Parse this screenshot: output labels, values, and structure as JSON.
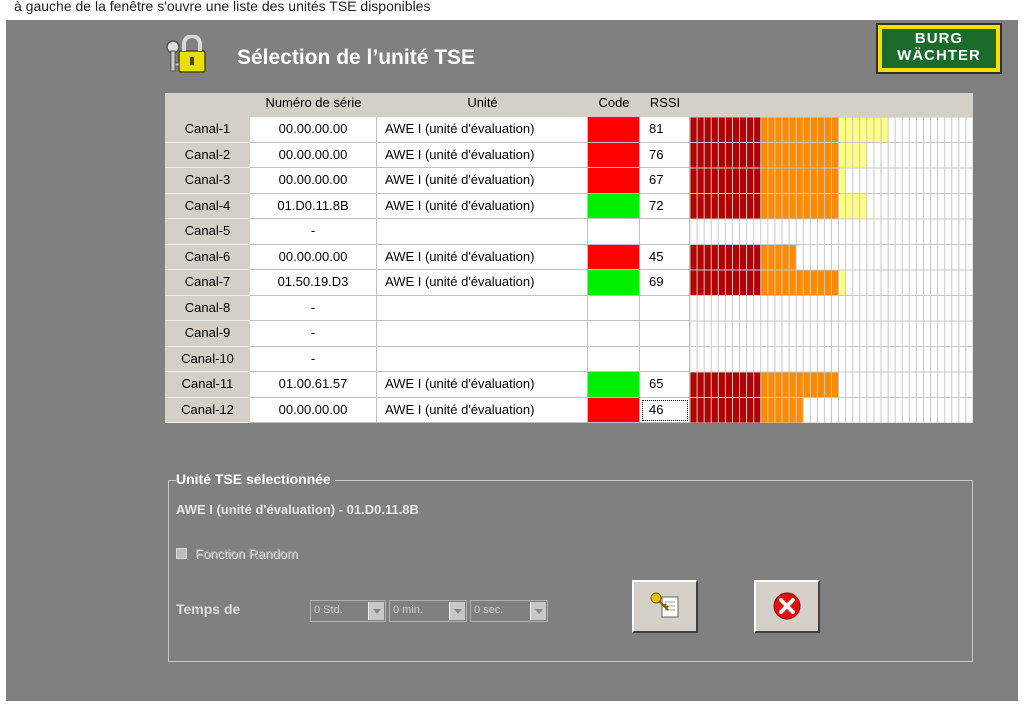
{
  "top_caption": "à gauche de la fenêtre s'ouvre une liste des unités TSE disponibles",
  "title": "Sélection de l’unité TSE",
  "logo": {
    "line1": "BURG",
    "line2": "WÄCHTER"
  },
  "table": {
    "headers": {
      "serial": "Numéro de série",
      "unit": "Unité",
      "code": "Code",
      "rssi": "RSSI"
    },
    "rows": [
      {
        "channel": "Canal-1",
        "serial": "00.00.00.00",
        "unit": "AWE I (unité d'évaluation)",
        "code": "red",
        "rssi": "81",
        "bar": 0.69
      },
      {
        "channel": "Canal-2",
        "serial": "00.00.00.00",
        "unit": "AWE I (unité d'évaluation)",
        "code": "red",
        "rssi": "76",
        "bar": 0.63
      },
      {
        "channel": "Canal-3",
        "serial": "00.00.00.00",
        "unit": "AWE I (unité d'évaluation)",
        "code": "red",
        "rssi": "67",
        "bar": 0.54
      },
      {
        "channel": "Canal-4",
        "serial": "01.D0.11.8B",
        "unit": "AWE I (unité d'évaluation)",
        "code": "green",
        "rssi": "72",
        "bar": 0.63
      },
      {
        "channel": "Canal-5",
        "serial": "-",
        "unit": "",
        "code": "",
        "rssi": "",
        "bar": 0
      },
      {
        "channel": "Canal-6",
        "serial": "00.00.00.00",
        "unit": "AWE I (unité d'évaluation)",
        "code": "red",
        "rssi": "45",
        "bar": 0.37
      },
      {
        "channel": "Canal-7",
        "serial": "01.50.19.D3",
        "unit": "AWE I (unité d'évaluation)",
        "code": "green",
        "rssi": "69",
        "bar": 0.56
      },
      {
        "channel": "Canal-8",
        "serial": "-",
        "unit": "",
        "code": "",
        "rssi": "",
        "bar": 0
      },
      {
        "channel": "Canal-9",
        "serial": "-",
        "unit": "",
        "code": "",
        "rssi": "",
        "bar": 0
      },
      {
        "channel": "Canal-10",
        "serial": "-",
        "unit": "",
        "code": "",
        "rssi": "",
        "bar": 0
      },
      {
        "channel": "Canal-11",
        "serial": "01.00.61.57",
        "unit": "AWE I (unité d'évaluation)",
        "code": "green",
        "rssi": "65",
        "bar": 0.53
      },
      {
        "channel": "Canal-12",
        "serial": "00.00.00.00",
        "unit": "AWE I (unité d'évaluation)",
        "code": "red",
        "rssi": "46",
        "bar": 0.4,
        "selected": true
      }
    ]
  },
  "bar_colors": [
    "#b30000",
    "#ff8c00",
    "#ffff80"
  ],
  "selection": {
    "group_label": "Unité TSE sélectionnée",
    "selected_text": "AWE I (unité d'évaluation) - 01.D0.11.8B",
    "random_label": "Fonction Random",
    "temps_label": "Temps de",
    "hours": "0 Std.",
    "minutes": "0 min.",
    "seconds": "0 sec."
  },
  "buttons": {
    "confirm_icon": "key-document-icon",
    "cancel_icon": "red-x-circle-icon"
  },
  "colors": {
    "panel": "#808080",
    "code_red": "#ff0000",
    "code_green": "#00ee00"
  }
}
